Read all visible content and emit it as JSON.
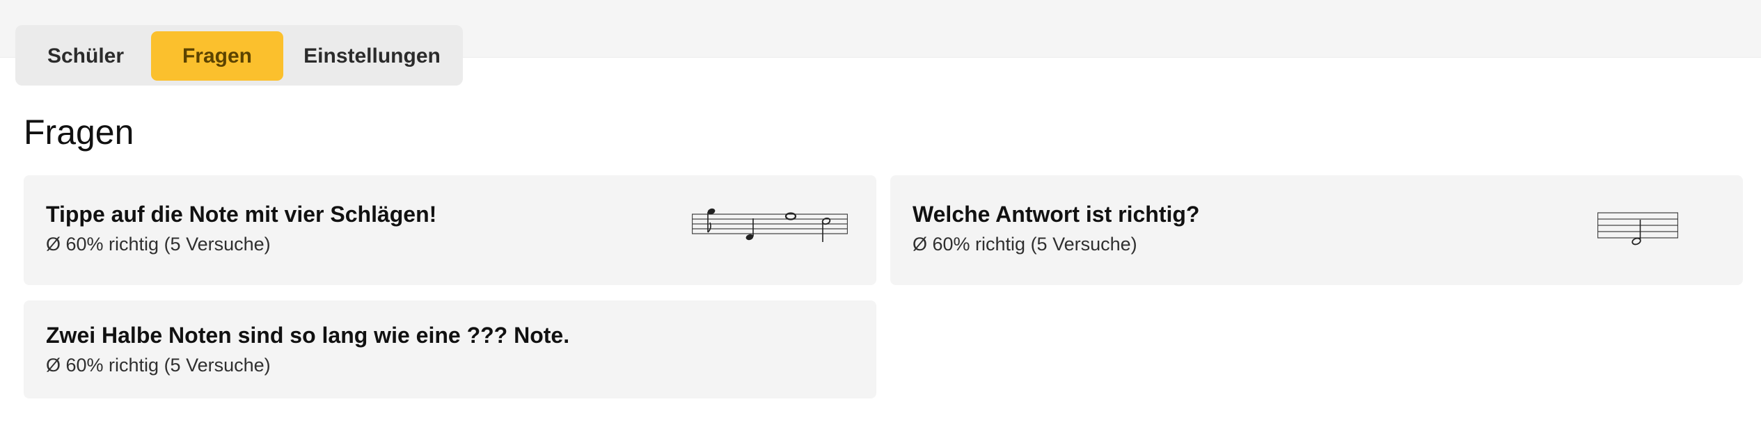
{
  "tabs": [
    {
      "label": "Schüler",
      "active": false
    },
    {
      "label": "Fragen",
      "active": true
    },
    {
      "label": "Einstellungen",
      "active": false
    }
  ],
  "page": {
    "title": "Fragen"
  },
  "questions": [
    {
      "title": "Tippe auf die Note mit vier Schlägen!",
      "stats": "Ø 60% richtig (5 Versuche)",
      "illustration": "staff-four-notes-icon"
    },
    {
      "title": "Welche Antwort ist richtig?",
      "stats": "Ø 60% richtig (5 Versuche)",
      "illustration": "staff-half-note-icon"
    },
    {
      "title": "Zwei Halbe Noten sind so lang wie eine ??? Note.",
      "stats": "Ø 60% richtig (5 Versuche)"
    }
  ],
  "colors": {
    "accent": "#fbc02d",
    "card_bg": "#f4f4f4",
    "topbar_bg": "#f5f5f5"
  }
}
